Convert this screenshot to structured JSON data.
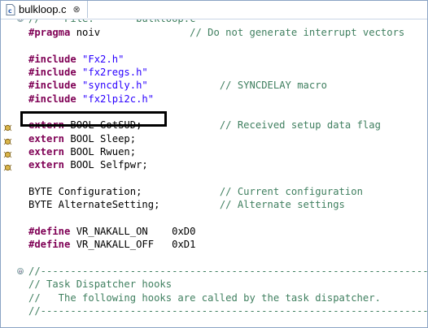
{
  "tab": {
    "label": "bulkloop.c",
    "close_glyph": "⊗"
  },
  "code_lines": [
    {
      "id": "l0",
      "parts": [
        [
          "cm",
          "//    File:       bulkloop.c"
        ]
      ]
    },
    {
      "id": "l1",
      "parts": [
        [
          "pp",
          "#pragma"
        ],
        [
          "",
          " noiv               "
        ],
        [
          "cm",
          "// Do not generate interrupt vectors"
        ]
      ]
    },
    {
      "id": "l2",
      "parts": []
    },
    {
      "id": "l3",
      "parts": [
        [
          "pp",
          "#include"
        ],
        [
          "",
          " "
        ],
        [
          "str",
          "\"Fx2.h\""
        ]
      ]
    },
    {
      "id": "l4",
      "parts": [
        [
          "pp",
          "#include"
        ],
        [
          "",
          " "
        ],
        [
          "str",
          "\"fx2regs.h\""
        ]
      ]
    },
    {
      "id": "l5",
      "parts": [
        [
          "pp",
          "#include"
        ],
        [
          "",
          " "
        ],
        [
          "str",
          "\"syncdly.h\""
        ],
        [
          "",
          "            "
        ],
        [
          "cm",
          "// SYNCDELAY macro"
        ]
      ]
    },
    {
      "id": "l6",
      "parts": [
        [
          "pp",
          "#include"
        ],
        [
          "",
          " "
        ],
        [
          "str",
          "\"fx2lpi2c.h\""
        ]
      ]
    },
    {
      "id": "l7",
      "parts": []
    },
    {
      "id": "l8",
      "parts": [
        [
          "kw",
          "extern"
        ],
        [
          "",
          " BOOL GotSUD;             "
        ],
        [
          "cm",
          "// Received setup data flag"
        ]
      ]
    },
    {
      "id": "l9",
      "parts": [
        [
          "kw",
          "extern"
        ],
        [
          "",
          " BOOL Sleep;"
        ]
      ]
    },
    {
      "id": "l10",
      "parts": [
        [
          "kw",
          "extern"
        ],
        [
          "",
          " BOOL Rwuen;"
        ]
      ]
    },
    {
      "id": "l11",
      "parts": [
        [
          "kw",
          "extern"
        ],
        [
          "",
          " BOOL Selfpwr;"
        ]
      ]
    },
    {
      "id": "l12",
      "parts": []
    },
    {
      "id": "l13",
      "parts": [
        [
          "",
          "BYTE Configuration;             "
        ],
        [
          "cm",
          "// Current configuration"
        ]
      ]
    },
    {
      "id": "l14",
      "parts": [
        [
          "",
          "BYTE AlternateSetting;          "
        ],
        [
          "cm",
          "// Alternate settings"
        ]
      ]
    },
    {
      "id": "l15",
      "parts": []
    },
    {
      "id": "l16",
      "parts": [
        [
          "pp",
          "#define"
        ],
        [
          "",
          " VR_NAKALL_ON    0xD0"
        ]
      ]
    },
    {
      "id": "l17",
      "parts": [
        [
          "pp",
          "#define"
        ],
        [
          "",
          " VR_NAKALL_OFF   0xD1"
        ]
      ]
    },
    {
      "id": "l18",
      "parts": []
    },
    {
      "id": "l19",
      "parts": [
        [
          "cm",
          "//-----------------------------------------------------------------------"
        ]
      ]
    },
    {
      "id": "l20",
      "parts": [
        [
          "cm",
          "// Task Dispatcher hooks"
        ]
      ]
    },
    {
      "id": "l21",
      "parts": [
        [
          "cm",
          "//   The following hooks are called by the task dispatcher."
        ]
      ]
    },
    {
      "id": "l22",
      "parts": [
        [
          "cm",
          "//-----------------------------------------------------------------------"
        ]
      ]
    }
  ],
  "marker_rows": [
    "l8",
    "l9",
    "l10",
    "l11"
  ],
  "fold_rows": [
    "l0",
    "l19"
  ],
  "colors": {
    "keyword": "#7f0055",
    "string": "#2a00ff",
    "comment": "#3f7f5f",
    "frame": "#8aa3c4"
  }
}
